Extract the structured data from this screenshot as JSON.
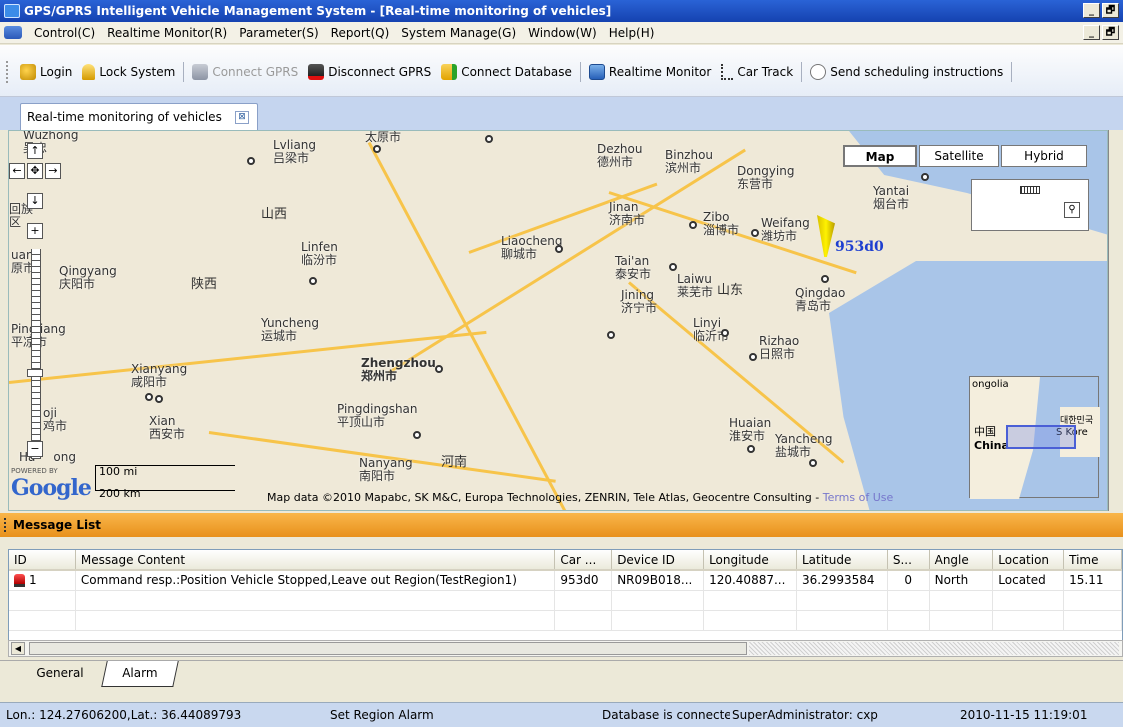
{
  "window": {
    "title": "GPS/GPRS Intelligent Vehicle Management System - [Real-time monitoring of vehicles]",
    "minimize": "_",
    "restore": "🗗"
  },
  "menu": {
    "items": [
      "Control(C)",
      "Realtime Monitor(R)",
      "Parameter(S)",
      "Report(Q)",
      "System Manage(G)",
      "Window(W)",
      "Help(H)"
    ]
  },
  "toolbar": {
    "login": "Login",
    "lock": "Lock System",
    "connect_gprs": "Connect GPRS",
    "disconnect_gprs": "Disconnect GPRS",
    "connect_db": "Connect Database",
    "realtime": "Realtime Monitor",
    "car_track": "Car Track",
    "scheduling": "Send scheduling instructions"
  },
  "tab": {
    "label": "Real-time monitoring of vehicles",
    "close": "⊠"
  },
  "map": {
    "type_map": "Map",
    "type_satellite": "Satellite",
    "type_hybrid": "Hybrid",
    "vehicle_label": "953d0",
    "scale_mi": "100 mi",
    "scale_km": "200 km",
    "powered_by": "POWERED BY",
    "google": "Google",
    "attribution": "Map data ©2010 Mapabc, SK M&C, Europa Technologies, ZENRIN, Tele Atlas, Geocentre Consulting - ",
    "terms": "Terms of Use",
    "mini_labels": {
      "mongolia": "ongolia",
      "china_cn": "中国",
      "china": "China",
      "korea": "S Kore",
      "korea_cn": "대한민국"
    },
    "provinces": {
      "shanxi": "山西",
      "shaanxi": "陕西",
      "shandong": "山东",
      "henan": "河南"
    },
    "cities": [
      {
        "en": "Wuzhong",
        "cn": "吴忠"
      },
      {
        "en": "Lvliang",
        "cn": "吕梁市"
      },
      {
        "en": "",
        "cn": "太原市"
      },
      {
        "en": "Dezhou",
        "cn": "德州市"
      },
      {
        "en": "Binzhou",
        "cn": "滨州市"
      },
      {
        "en": "Dongying",
        "cn": "东营市"
      },
      {
        "en": "Yantai",
        "cn": "烟台市"
      },
      {
        "en": "Jinan",
        "cn": "济南市"
      },
      {
        "en": "Zibo",
        "cn": "淄博市"
      },
      {
        "en": "Weifang",
        "cn": "潍坊市"
      },
      {
        "en": "Liaocheng",
        "cn": "聊城市"
      },
      {
        "en": "Tai'an",
        "cn": "泰安市"
      },
      {
        "en": "Laiwu",
        "cn": "莱芜市"
      },
      {
        "en": "Jining",
        "cn": "济宁市"
      },
      {
        "en": "Qingdao",
        "cn": "青岛市"
      },
      {
        "en": "Linfen",
        "cn": "临汾市"
      },
      {
        "en": "Qingyang",
        "cn": "庆阳市"
      },
      {
        "en": "Yuncheng",
        "cn": "运城市"
      },
      {
        "en": "Linyi",
        "cn": "临沂市"
      },
      {
        "en": "Rizhao",
        "cn": "日照市"
      },
      {
        "en": "Zhengzhou",
        "cn": "郑州市"
      },
      {
        "en": "Xianyang",
        "cn": "咸阳市"
      },
      {
        "en": "Xian",
        "cn": "西安市"
      },
      {
        "en": "Pingdingshan",
        "cn": "平顶山市"
      },
      {
        "en": "Huaian",
        "cn": "淮安市"
      },
      {
        "en": "Yancheng",
        "cn": "盐城市"
      },
      {
        "en": "Nanyang",
        "cn": "南阳市"
      },
      {
        "en": "Pingliang",
        "cn": "平凉市"
      },
      {
        "en": "uan",
        "cn": "原市"
      },
      {
        "en": "Ha",
        "cn": "ong"
      },
      {
        "en": "oji",
        "cn": "鸡市"
      },
      {
        "en": "",
        "cn": "回族"
      },
      {
        "en": "",
        "cn": "区"
      }
    ]
  },
  "message_list": {
    "title": "Message List",
    "columns": [
      "ID",
      "Message Content",
      "Car ...",
      "Device ID",
      "Longitude",
      "Latitude",
      "S...",
      "Angle",
      "Location",
      "Time"
    ],
    "rows": [
      {
        "id": "1",
        "content": "Command resp.:Position  Vehicle Stopped,Leave out Region(TestRegion1)",
        "car": "953d0",
        "device": "NR09B018...",
        "lon": "120.40887...",
        "lat": "36.2993584",
        "speed": "0",
        "angle": "North",
        "location": "Located",
        "time": "15.11"
      }
    ]
  },
  "bottom_tabs": {
    "general": "General",
    "alarm": "Alarm"
  },
  "status": {
    "coords": "Lon.: 124.27606200,Lat.: 36.44089793",
    "alarm": "Set Region Alarm",
    "db": "Database is connected",
    "user": "SuperAdministrator:  cxp",
    "datetime": "2010-11-15 11:19:01"
  }
}
